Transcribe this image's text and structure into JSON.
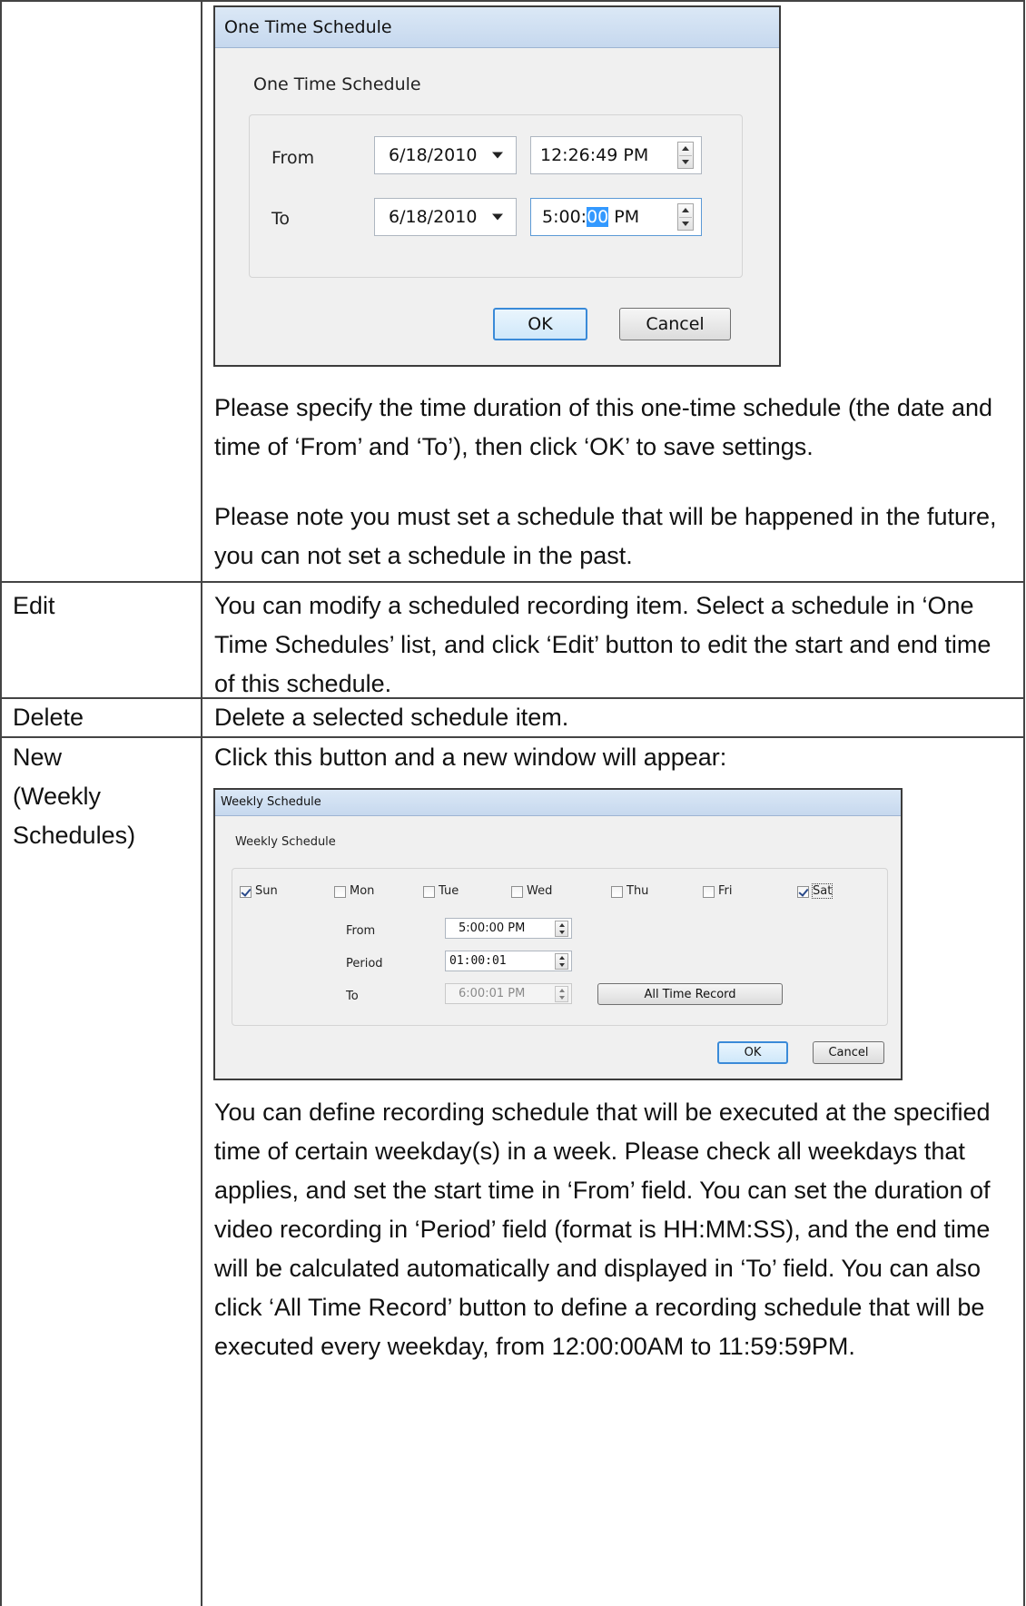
{
  "dialog_one_time": {
    "title": "One Time Schedule",
    "group_label": "One Time Schedule",
    "from_label": "From",
    "to_label": "To",
    "from_date": "6/18/2010",
    "from_time": "12:26:49 PM",
    "to_date": "6/18/2010",
    "to_time_prefix": "5:00:",
    "to_time_selected": "00",
    "to_time_suffix": " PM",
    "ok_label": "OK",
    "cancel_label": "Cancel"
  },
  "text": {
    "one_time_desc_1": "Please specify the time duration of this one-time schedule (the date and time of ‘From’ and ‘To’), then click ‘OK’ to save settings.",
    "one_time_desc_2": "Please note you must set a schedule that will be happened in the future, you can not set a schedule in the past."
  },
  "rows": [
    {
      "name": "Edit",
      "desc": "You can modify a scheduled recording item. Select a schedule in ‘One Time Schedules’ list, and click ‘Edit’ button to edit the start and end time of this schedule."
    },
    {
      "name": "Delete",
      "desc": "Delete a selected schedule item."
    },
    {
      "name_line1": "New",
      "name_line2": "(Weekly",
      "name_line3": "Schedules)",
      "desc": "Click this button and a new window will appear:"
    }
  ],
  "dialog_weekly": {
    "title": "Weekly Schedule",
    "group_label": "Weekly Schedule",
    "days": [
      {
        "label": "Sun",
        "checked": true
      },
      {
        "label": "Mon",
        "checked": false
      },
      {
        "label": "Tue",
        "checked": false
      },
      {
        "label": "Wed",
        "checked": false
      },
      {
        "label": "Thu",
        "checked": false
      },
      {
        "label": "Fri",
        "checked": false
      },
      {
        "label": "Sat",
        "checked": true
      }
    ],
    "from_label": "From",
    "period_label": "Period",
    "to_label": "To",
    "from_value": "5:00:00 PM",
    "period_value": "01:00:01",
    "to_value": "6:00:01 PM",
    "all_time_label": "All Time Record",
    "ok_label": "OK",
    "cancel_label": "Cancel"
  },
  "weekly_desc": "You can define recording schedule that will be executed at the specified time of certain weekday(s) in a week. Please check all weekdays that applies, and set the start time in ‘From’ field. You can set the duration of video recording in ‘Period’ field (format is HH:MM:SS), and the end time will be calculated automatically and displayed in ‘To’ field. You can also click ‘All Time Record’ button to define a recording schedule that will be executed every weekday, from 12:00:00AM to 11:59:59PM."
}
